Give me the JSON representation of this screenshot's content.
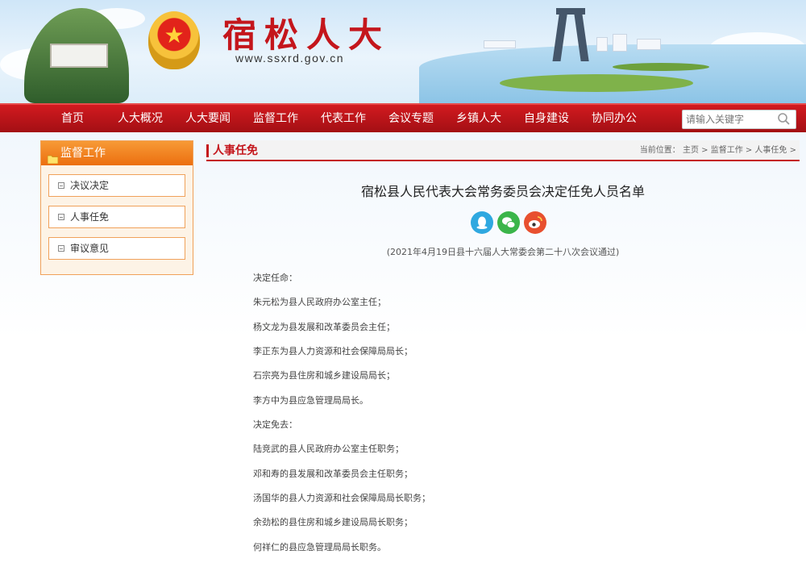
{
  "site": {
    "title": "宿松人大",
    "url": "www.ssxrd.gov.cn"
  },
  "nav": {
    "items": [
      "首页",
      "人大概况",
      "人大要闻",
      "监督工作",
      "代表工作",
      "会议专题",
      "乡镇人大",
      "自身建设",
      "协同办公"
    ],
    "search_placeholder": "请输入关键字"
  },
  "sidebar": {
    "title": "监督工作",
    "items": [
      "决议决定",
      "人事任免",
      "审议意见"
    ]
  },
  "section": {
    "title": "人事任免",
    "breadcrumb": "当前位置： 主页 > 监督工作 > 人事任免 >"
  },
  "article": {
    "title": "宿松县人民代表大会常务委员会决定任免人员名单",
    "subtitle": "(2021年4月19日县十六届人大常委会第二十八次会议通过)",
    "lines": [
      "决定任命：",
      "朱元松为县人民政府办公室主任；",
      "杨文龙为县发展和改革委员会主任；",
      "李正东为县人力资源和社会保障局局长；",
      "石宗亮为县住房和城乡建设局局长；",
      "李方中为县应急管理局局长。",
      "决定免去：",
      "陆竞武的县人民政府办公室主任职务；",
      "邓和寿的县发展和改革委员会主任职务；",
      "汤国华的县人力资源和社会保障局局长职务；",
      "余劲松的县住房和城乡建设局局长职务；",
      "何祥仁的县应急管理局局长职务。"
    ]
  },
  "share": {
    "icons": [
      "qq-icon",
      "wechat-icon",
      "weibo-icon"
    ],
    "colors": [
      "#2fa8e0",
      "#3bb54a",
      "#e8502f"
    ]
  },
  "colors": {
    "brand_red": "#c4161c",
    "sidebar_orange": "#ec6f10"
  }
}
